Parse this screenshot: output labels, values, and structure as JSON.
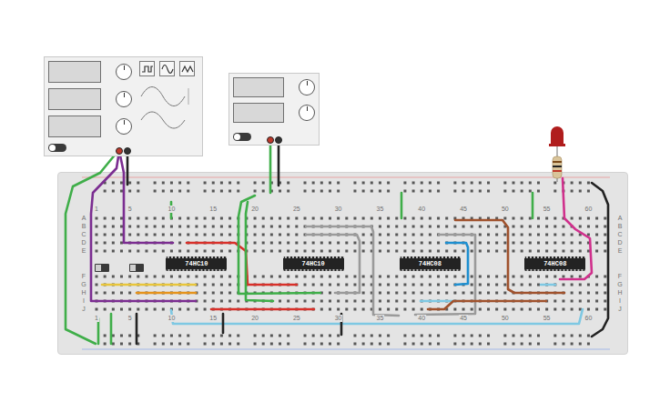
{
  "function_generator": {
    "power_on": false,
    "waveforms": [
      {
        "kind": "square",
        "selected": false
      },
      {
        "kind": "sine",
        "selected": false
      },
      {
        "kind": "triangle",
        "selected": false
      }
    ],
    "terminals": [
      {
        "color": "#c0392b"
      },
      {
        "color": "#333333"
      }
    ]
  },
  "power_supply": {
    "power_on": false,
    "terminals": [
      {
        "color": "#c0392b"
      },
      {
        "color": "#333333"
      }
    ]
  },
  "breadboard": {
    "column_labels": [
      "1",
      "5",
      "10",
      "15",
      "20",
      "25",
      "30",
      "35",
      "40",
      "45",
      "50",
      "55",
      "60"
    ],
    "row_labels": [
      "A",
      "B",
      "C",
      "D",
      "E",
      "F",
      "G",
      "H",
      "I",
      "J"
    ]
  },
  "chips": [
    {
      "label": "74HC10"
    },
    {
      "label": "74HC10"
    },
    {
      "label": "74HC08"
    },
    {
      "label": "74HC08"
    }
  ],
  "switches": [
    {
      "on": false
    },
    {
      "on": false
    }
  ],
  "led": {
    "color": "#b01d1d",
    "on": false
  },
  "wires": [
    {
      "color": "#7b2d91"
    },
    {
      "color": "#7b2d91"
    },
    {
      "color": "#3fae49"
    },
    {
      "color": "#222222"
    },
    {
      "color": "#3fae49"
    },
    {
      "color": "#222222"
    },
    {
      "color": "#3fae49"
    },
    {
      "color": "#3fae49"
    },
    {
      "color": "#3fae49"
    },
    {
      "color": "#d8302a"
    },
    {
      "color": "#3fae49"
    },
    {
      "color": "#3fae49"
    },
    {
      "color": "#d8302a"
    },
    {
      "color": "#9a9a9a"
    },
    {
      "color": "#9a9a9a"
    },
    {
      "color": "#9a9a9a"
    },
    {
      "color": "#1e8fd0"
    },
    {
      "color": "#7ec8e3"
    },
    {
      "color": "#7ec8e3"
    },
    {
      "color": "#7ec8e3"
    },
    {
      "color": "#a0522d"
    },
    {
      "color": "#a0522d"
    },
    {
      "color": "#e8c53a"
    },
    {
      "color": "#e5931c"
    },
    {
      "color": "#222222"
    },
    {
      "color": "#222222"
    },
    {
      "color": "#222222"
    },
    {
      "color": "#3fae49"
    },
    {
      "color": "#3fae49"
    },
    {
      "color": "#222222"
    },
    {
      "color": "#d0308c"
    }
  ]
}
